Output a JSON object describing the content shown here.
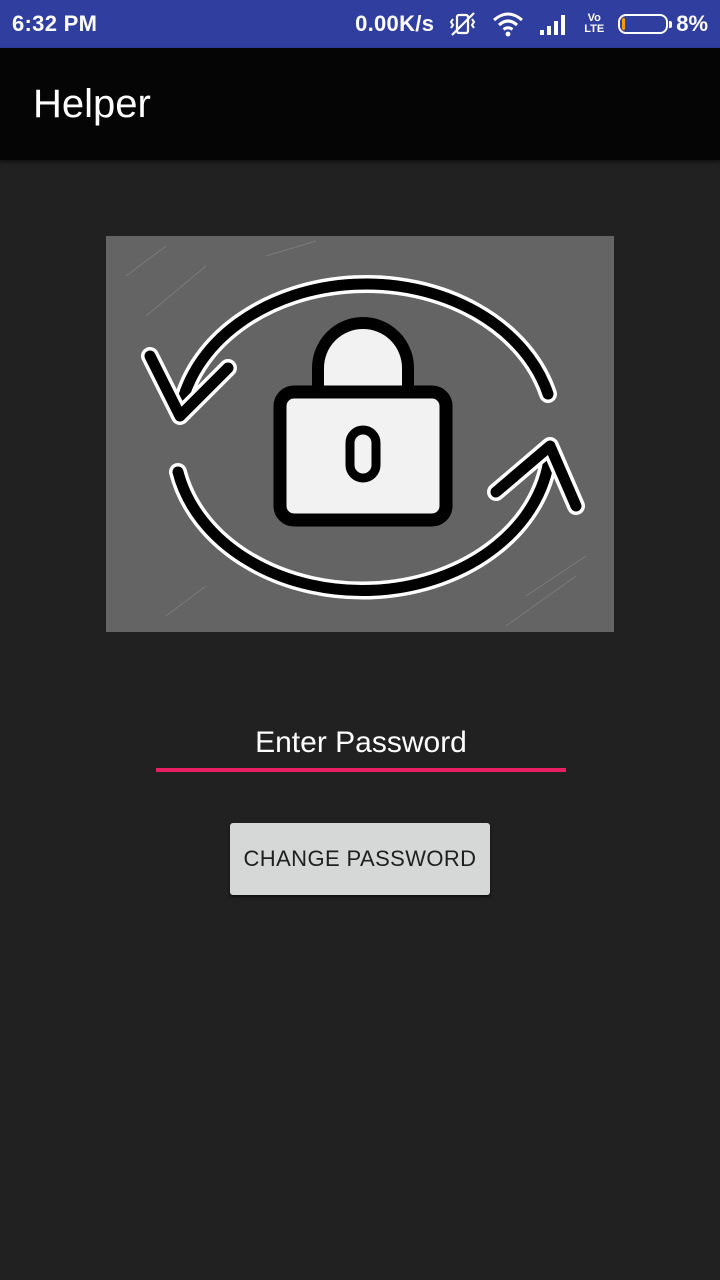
{
  "status_bar": {
    "time": "6:32 PM",
    "net_speed": "0.00K/s",
    "volte_top": "Vo",
    "volte_bottom": "LTE",
    "battery_percent": "8%",
    "battery_level": 0.08,
    "icons": [
      "vibrate-icon",
      "wifi-icon",
      "signal-icon",
      "volte-icon",
      "battery-icon"
    ],
    "background": "#303f9f"
  },
  "app_bar": {
    "title": "Helper",
    "background": "#050505"
  },
  "main": {
    "image": {
      "icon": "lock-refresh-icon"
    },
    "password_input": {
      "value": "",
      "placeholder": "Enter Password",
      "accent": "#e91e63"
    },
    "change_button": {
      "label": "CHANGE PASSWORD"
    }
  },
  "theme": {
    "background": "#212121"
  }
}
